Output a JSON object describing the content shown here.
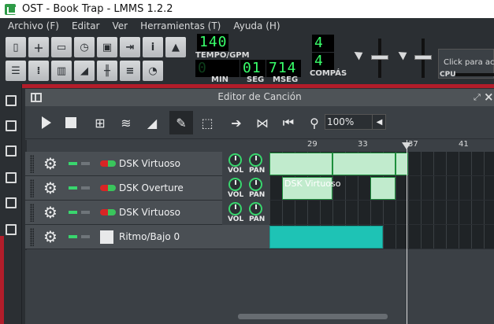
{
  "window": {
    "title": "OST - Book Trap - LMMS 1.2.2"
  },
  "menu": [
    "Archivo (F)",
    "Editar",
    "Ver",
    "Herramientas (T)",
    "Ayuda (H)"
  ],
  "toolbar": {
    "tempo_value": "140",
    "tempo_label": "TEMPO/GPM",
    "time_min": "0",
    "time_seg": "01",
    "time_mseg": "714",
    "min_label": "MIN",
    "seg_label": "SEG",
    "mseg_label": "MSEG",
    "sig_numerator": "4",
    "sig_denominator": "4",
    "compas_label": "COMPÁS",
    "cpu_hint": "Click para acti",
    "cpu_label": "CPU"
  },
  "song_editor": {
    "title": "Editor de Canción",
    "zoom": "100%",
    "bar_numbers": [
      "29",
      "33",
      "37",
      "41"
    ],
    "tracks": [
      {
        "name": "DSK Virtuoso",
        "vol_label": "VOL",
        "pan_label": "PAN"
      },
      {
        "name": "DSK Overture",
        "vol_label": "VOL",
        "pan_label": "PAN",
        "clip_label": "DSK Virtuoso"
      },
      {
        "name": "DSK Virtuoso",
        "vol_label": "VOL",
        "pan_label": "PAN"
      },
      {
        "name": "Ritmo/Bajo 0"
      }
    ]
  },
  "colors": {
    "accent_green": "#27b94f",
    "beat_clip": "#1ec3b5",
    "lcd_green": "#38ff6a",
    "red_accent": "#b21d2a"
  }
}
